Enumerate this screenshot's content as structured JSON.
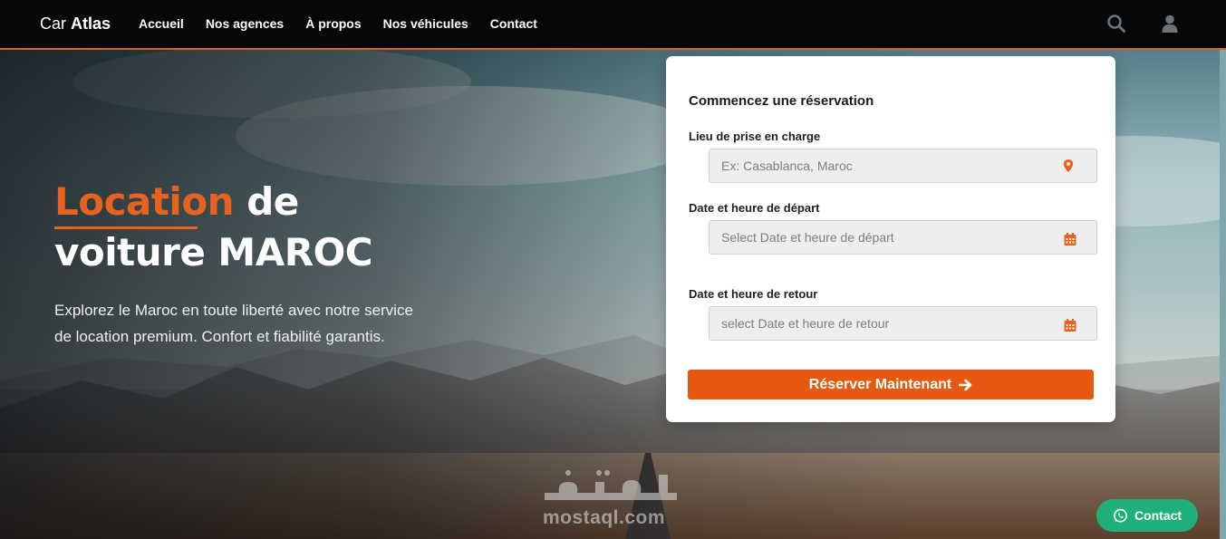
{
  "nav": {
    "brand_light": "Car",
    "brand_bold": "Atlas",
    "items": [
      {
        "label": "Accueil"
      },
      {
        "label": "Nos agences"
      },
      {
        "label": "À propos"
      },
      {
        "label": "Nos véhicules"
      },
      {
        "label": "Contact"
      }
    ],
    "icons": [
      "search-icon",
      "user-icon"
    ]
  },
  "hero": {
    "title_accent": "Location",
    "title_rest_1": " de",
    "title_line_2": "voiture MAROC",
    "lead": "Explorez le Maroc en toute liberté avec notre service de location premium. Confort et fiabilité garantis."
  },
  "booking": {
    "heading": "Commencez une réservation",
    "pickup_label": "Lieu de prise en charge",
    "pickup_placeholder": "Ex: Casablanca, Maroc",
    "depart_label": "Date et heure de départ",
    "depart_placeholder": "Select Date et heure de départ",
    "return_label": "Date et heure de retour",
    "return_placeholder": "select Date et heure de retour",
    "submit_label": "Réserver Maintenant"
  },
  "watermark": {
    "latin": "mostaql.com"
  },
  "whatsapp": {
    "label": "Contact"
  },
  "colors": {
    "accent": "#e8621f",
    "button": "#e55a10",
    "whatsapp": "#1fb07a",
    "nav_bg": "#050708"
  }
}
